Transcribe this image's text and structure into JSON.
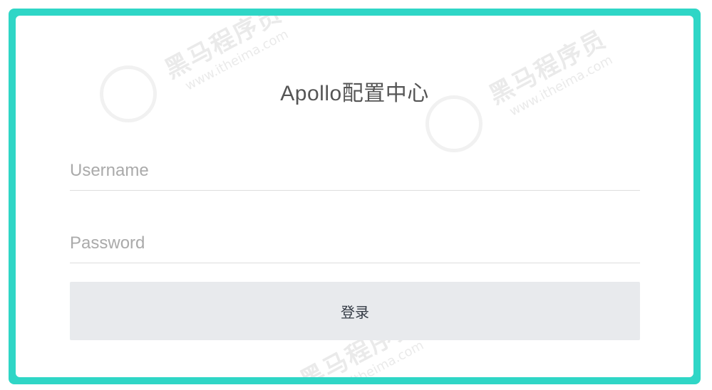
{
  "login": {
    "title": "Apollo配置中心",
    "username_placeholder": "Username",
    "password_placeholder": "Password",
    "submit_label": "登录"
  },
  "watermark": {
    "brand": "黑马程序员",
    "url": "www.itheima.com"
  },
  "colors": {
    "frame": "#2fd6c6",
    "card": "#ffffff",
    "button": "#e8eaed"
  }
}
